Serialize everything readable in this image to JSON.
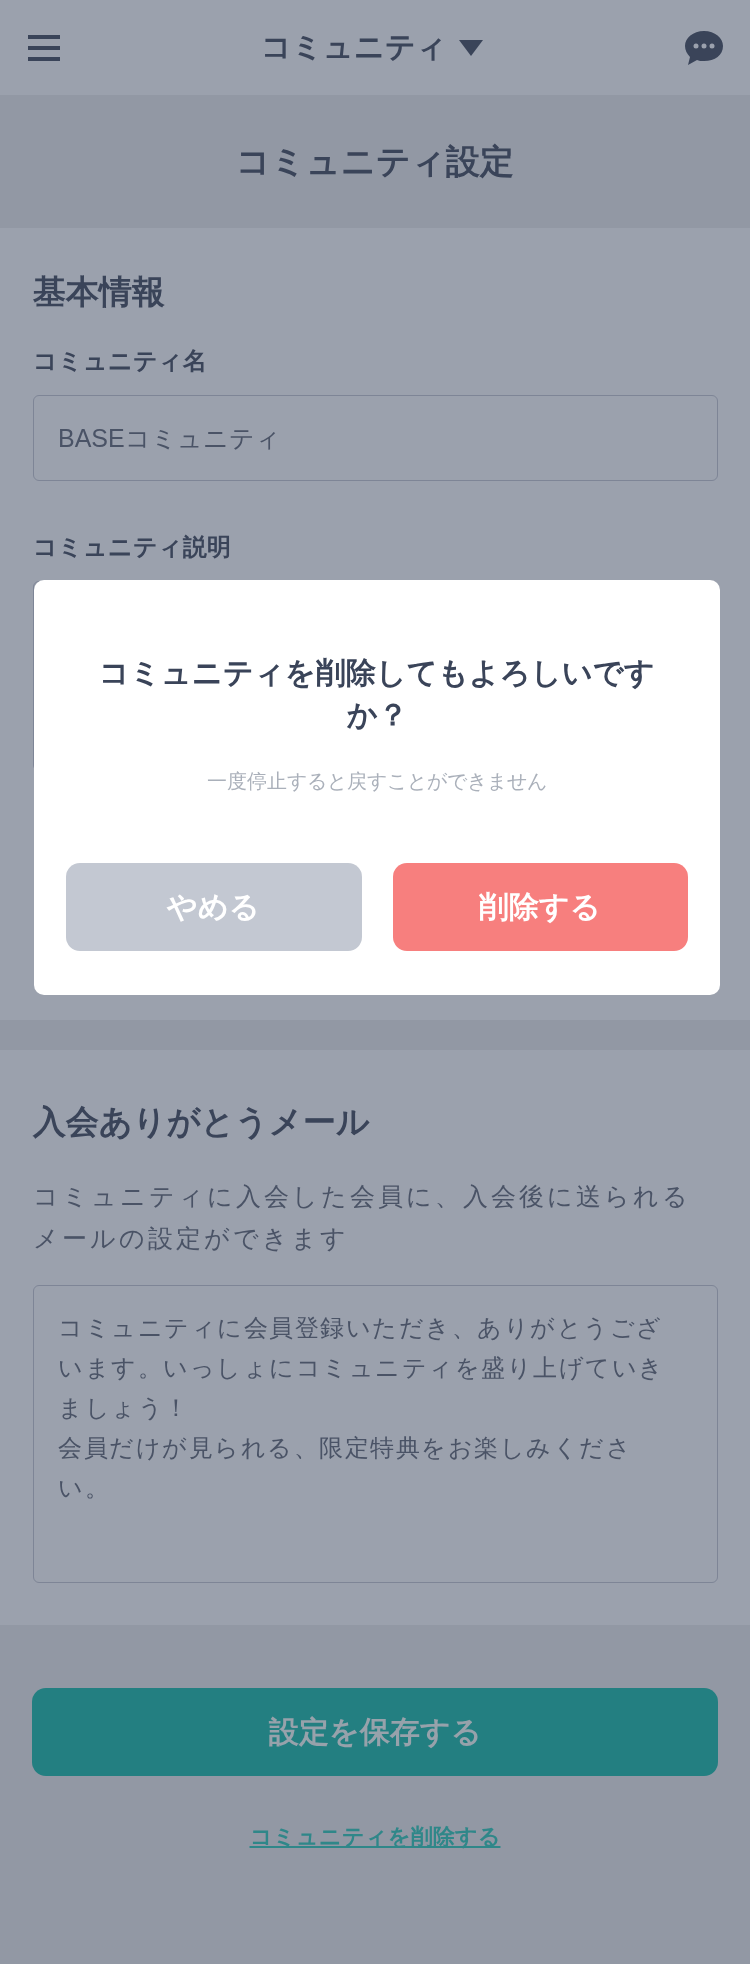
{
  "header": {
    "title": "コミュニティ"
  },
  "page_title": "コミュニティ設定",
  "basic_info": {
    "heading": "基本情報",
    "fields": [
      {
        "label": "コミュニティ名",
        "value": "BASEコミュニティ"
      },
      {
        "label": "コミュニティ説明"
      }
    ]
  },
  "welcome_mail": {
    "heading": "入会ありがとうメール",
    "description": "コミュニティに入会した会員に、入会後に送られるメールの設定ができます",
    "body": [
      "コミュニティに会員登録いただき、ありがとうございます。いっしょにコミュニティを盛り上げていきましょう！",
      "会員だけが見られる、限定特典をお楽しみください。"
    ]
  },
  "save_button": "設定を保存する",
  "delete_link": "コミュニティを削除する",
  "dialog": {
    "title": "コミュニティを削除してもよろしいですか？",
    "message": "一度停止すると戻すことができません",
    "buttons": [
      {
        "label": "やめる",
        "kind": "cancel"
      },
      {
        "label": "削除する",
        "kind": "danger"
      }
    ]
  }
}
